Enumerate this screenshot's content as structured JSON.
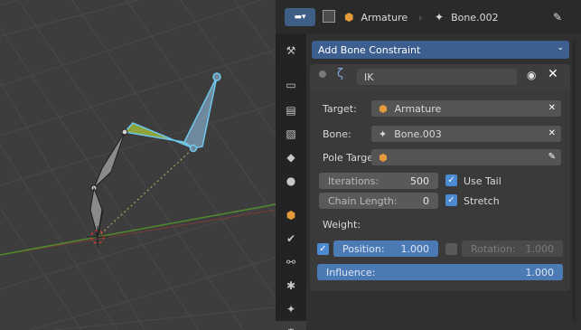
{
  "header": {
    "breadcrumb_object": "Armature",
    "breadcrumb_bone": "Bone.002"
  },
  "properties": {
    "add_constraint_label": "Add Bone Constraint",
    "constraint": {
      "name": "IK",
      "target_label": "Target:",
      "target_value": "Armature",
      "bone_label": "Bone:",
      "bone_value": "Bone.003",
      "pole_target_label": "Pole Target:",
      "iterations_label": "Iterations:",
      "iterations_value": "500",
      "chain_length_label": "Chain Length:",
      "chain_length_value": "0",
      "use_tail_label": "Use Tail",
      "use_tail_checked": true,
      "stretch_label": "Stretch",
      "stretch_checked": true,
      "weight_label": "Weight:",
      "position_label": "Position:",
      "position_value": "1.000",
      "position_checked": true,
      "rotation_label": "Rotation:",
      "rotation_value": "1.000",
      "rotation_checked": false,
      "influence_label": "Influence:",
      "influence_value": "1.000"
    }
  },
  "colors": {
    "accent_blue": "#4c7ab5",
    "selected_bone": "#5fb3dd",
    "ik_bone": "#b8c954"
  }
}
